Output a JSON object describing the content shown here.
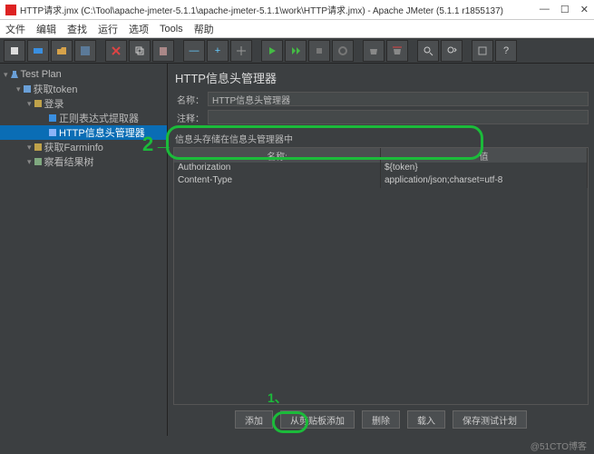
{
  "window": {
    "title": "HTTP请求.jmx (C:\\Tool\\apache-jmeter-5.1.1\\apache-jmeter-5.1.1\\work\\HTTP请求.jmx) - Apache JMeter (5.1.1 r1855137)",
    "controls": {
      "min": "—",
      "max": "☐",
      "close": "✕"
    }
  },
  "menu": [
    "文件",
    "编辑",
    "查找",
    "运行",
    "选项",
    "Tools",
    "帮助"
  ],
  "tree": {
    "root": "Test Plan",
    "items": [
      {
        "label": "获取token",
        "depth": 1,
        "icon": "thread-group",
        "color": "#6aa0d8"
      },
      {
        "label": "登录",
        "depth": 2,
        "icon": "sampler",
        "color": "#bfa24a"
      },
      {
        "label": "正则表达式提取器",
        "depth": 3,
        "icon": "extractor",
        "color": "#3a8fe0"
      },
      {
        "label": "HTTP信息头管理器",
        "depth": 3,
        "icon": "header-mgr",
        "color": "#8ab4f8",
        "selected": true
      },
      {
        "label": "获取Farminfo",
        "depth": 2,
        "icon": "sampler",
        "color": "#bfa24a"
      },
      {
        "label": "察看结果树",
        "depth": 2,
        "icon": "listener",
        "color": "#7fa87f"
      }
    ]
  },
  "panel": {
    "title": "HTTP信息头管理器",
    "name_label": "名称：",
    "name_value": "HTTP信息头管理器",
    "comment_label": "注释：",
    "comment_value": "",
    "section": "信息头存储在信息头管理器中",
    "columns": [
      "名称:",
      "值"
    ],
    "rows": [
      {
        "name": "Authorization",
        "value": "${token}"
      },
      {
        "name": "Content-Type",
        "value": "application/json;charset=utf-8"
      }
    ],
    "buttons": [
      "添加",
      "从剪贴板添加",
      "删除",
      "载入",
      "保存测试计划"
    ]
  },
  "annotations": {
    "arrow_in": "2→",
    "arrow_down": "1、"
  },
  "watermark": "@51CTO博客"
}
